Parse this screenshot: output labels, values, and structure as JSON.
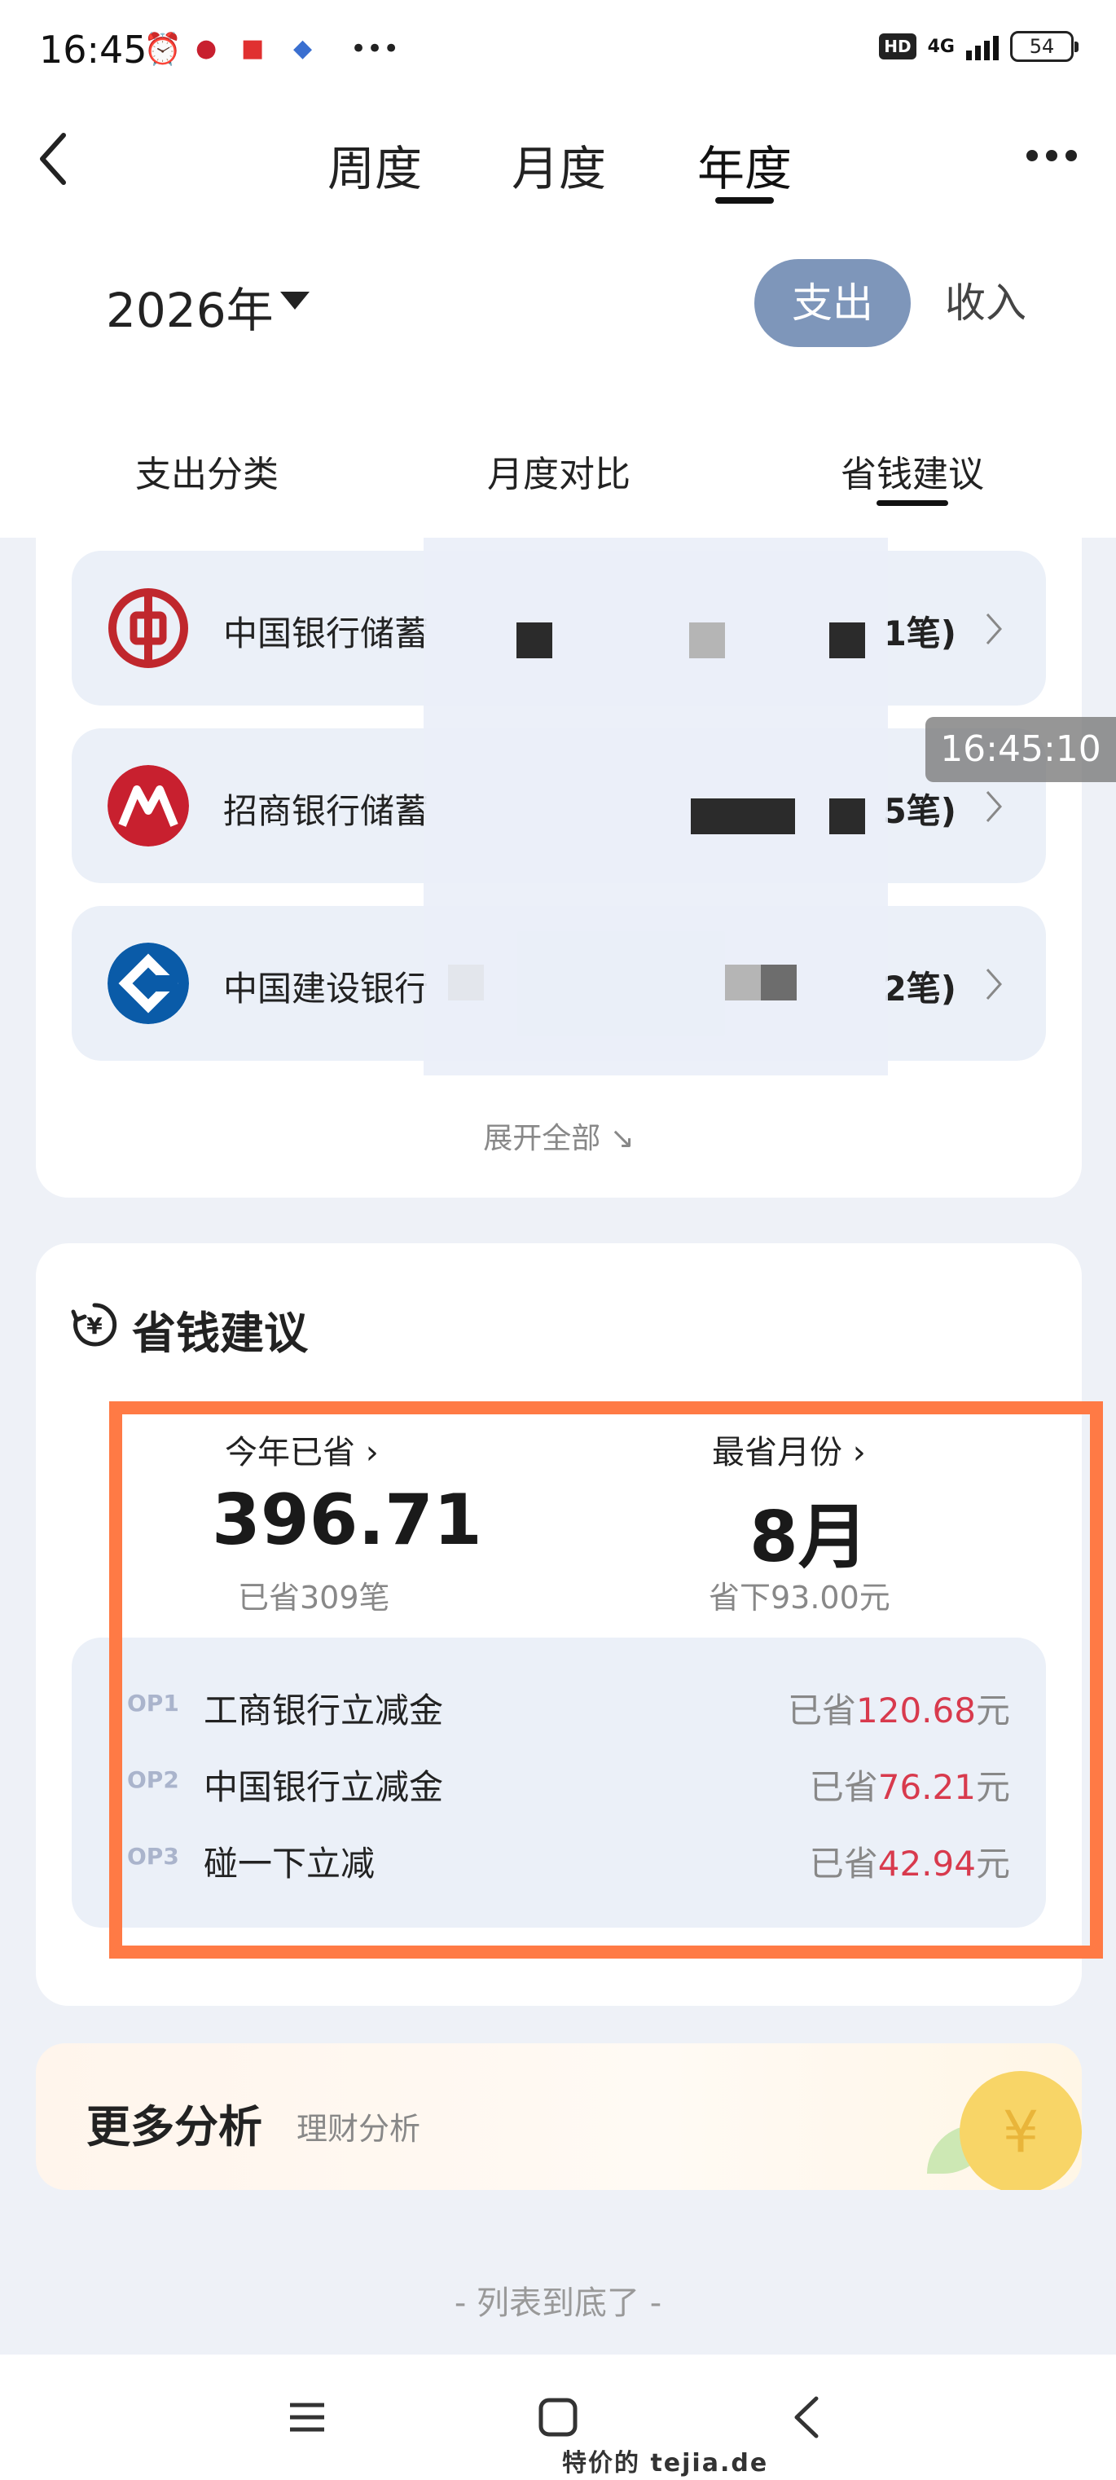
{
  "status_bar": {
    "time": "16:45",
    "network": "4G",
    "battery": "54"
  },
  "nav": {
    "tabs": [
      "周度",
      "月度",
      "年度"
    ],
    "active_tab": "年度"
  },
  "filter": {
    "year": "2026年",
    "expense_label": "支出",
    "income_label": "收入"
  },
  "sub_tabs": {
    "items": [
      "支出分类",
      "月度对比",
      "省钱建议"
    ],
    "active": "省钱建议"
  },
  "banks": [
    {
      "name": "中国银行储蓄",
      "count": "1笔)",
      "logo_color": "#c0272d"
    },
    {
      "name": "招商银行储蓄",
      "count": "5笔)",
      "logo_color": "#c8202f"
    },
    {
      "name": "中国建设银行",
      "count": "2笔)",
      "logo_color": "#0a5ba8"
    }
  ],
  "expand_all": "展开全部",
  "screenshot_timestamp": "16:45:10",
  "savings": {
    "title": "省钱建议",
    "year_saved_label": "今年已省",
    "year_saved_value": "396.71",
    "year_saved_sub": "已省309笔",
    "best_month_label": "最省月份",
    "best_month_value": "8月",
    "best_month_sub": "省下93.00元",
    "top": [
      {
        "rank": "OP1",
        "name": "工商银行立减金",
        "prefix": "已省",
        "amount": "120.68",
        "suffix": "元"
      },
      {
        "rank": "OP2",
        "name": "中国银行立减金",
        "prefix": "已省",
        "amount": "76.21",
        "suffix": "元"
      },
      {
        "rank": "OP3",
        "name": "碰一下立减",
        "prefix": "已省",
        "amount": "42.94",
        "suffix": "元"
      }
    ]
  },
  "more_analysis": {
    "title": "更多分析",
    "subtitle": "理财分析"
  },
  "end_of_list": "- 列表到底了 -",
  "watermark": "特价的 tejia.de",
  "colors": {
    "accent_toggle": "#7e96ba",
    "highlight_box": "#ff7a45",
    "amount_red": "#d83a4d"
  }
}
